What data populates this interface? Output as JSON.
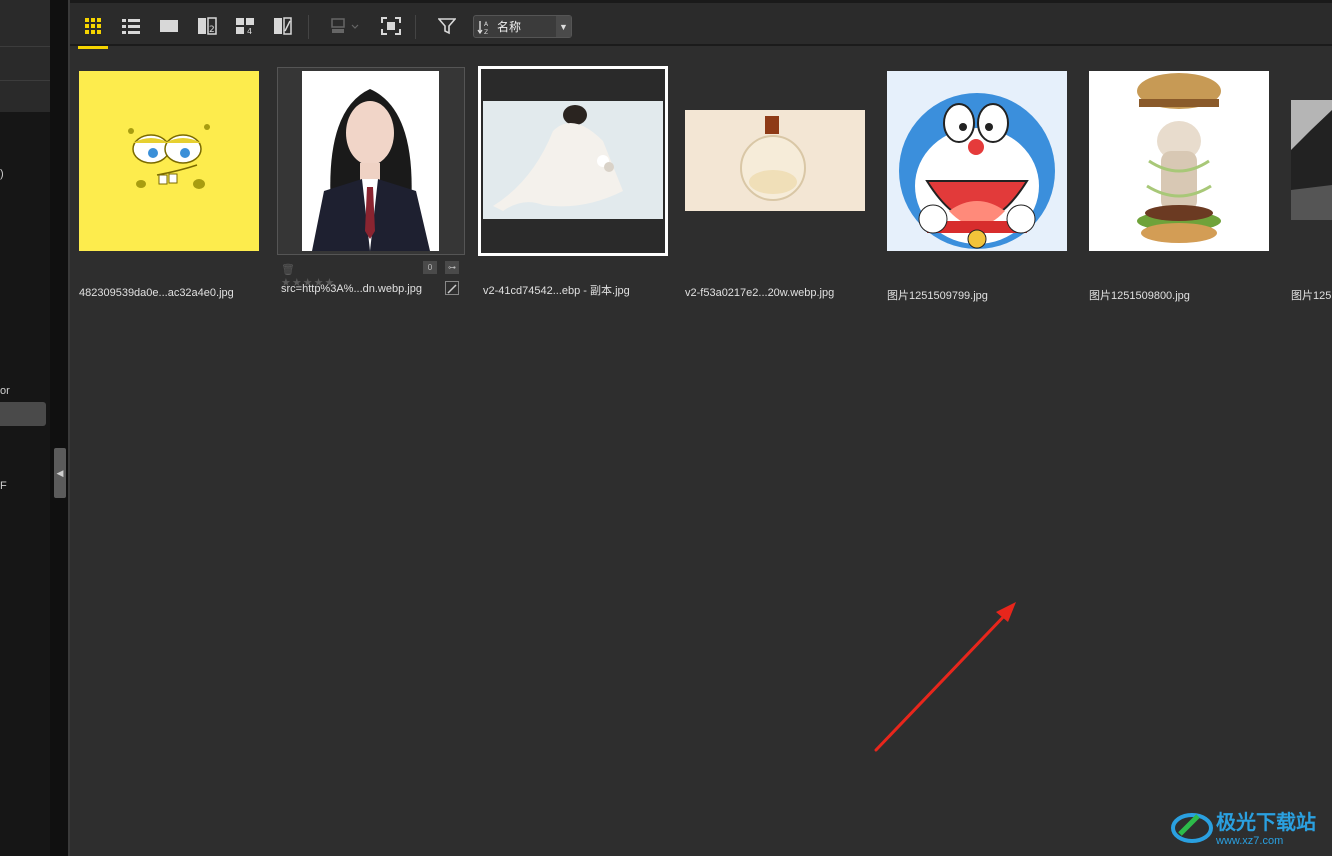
{
  "toolbar": {
    "view_buttons": [
      {
        "name": "grid-view",
        "active": true
      },
      {
        "name": "list-view",
        "active": false
      },
      {
        "name": "single-view",
        "active": false
      },
      {
        "name": "compare-2-view",
        "active": false
      },
      {
        "name": "compare-4-view",
        "active": false
      },
      {
        "name": "filmstrip-view",
        "active": false
      }
    ],
    "sort_label": "名称",
    "accent_color": "#f5d400"
  },
  "sidebar": {
    "fragments": [
      ")",
      "or",
      "F"
    ]
  },
  "thumbnails": [
    {
      "filename": "482309539da0e...ac32a4e0.jpg",
      "subject": "yellow cartoon sponge face"
    },
    {
      "filename": "src=http%3A%...dn.webp.jpg",
      "subject": "ID photo of person in school uniform",
      "hovered": true,
      "rating_badge": "0"
    },
    {
      "filename": "v2-41cd74542...ebp - 副本.jpg",
      "subject": "woman in white dress sitting",
      "selected": true
    },
    {
      "filename": "v2-f53a0217e2...20w.webp.jpg",
      "subject": "perfume bottle"
    },
    {
      "filename": "图片1251509799.jpg",
      "subject": "blue cartoon robot cat"
    },
    {
      "filename": "图片1251509800.jpg",
      "subject": "cat in a burger illustration"
    },
    {
      "filename": "图片125",
      "subject": "black and white landscape (cut off)"
    }
  ],
  "annotation": {
    "color": "#e8261c"
  }
}
